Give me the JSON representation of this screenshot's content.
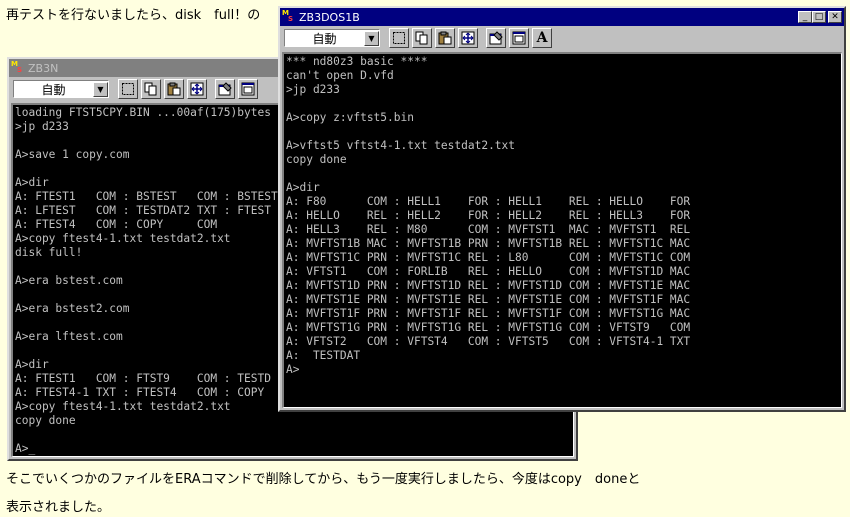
{
  "page": {
    "top_text": "再テストを行ないましたら、disk　full！の",
    "bottom_text_line1": "そこでいくつかのファイルをERAコマンドで削除してから、もう一度実行しましたら、今度はcopy　doneと",
    "bottom_text_line2": "表示されました。"
  },
  "windows": {
    "zb3n": {
      "title": "ZB3N",
      "mode_value": "自動",
      "terminal_text": "loading FTST5CPY.BIN ...00af(175)bytes\n>jp d233\n\nA>save 1 copy.com\n\nA>dir\nA: FTEST1   COM : BSTEST   COM : BSTEST\nA: LFTEST   COM : TESTDAT2 TXT : FTEST\nA: FTEST4   COM : COPY     COM\nA>copy ftest4-1.txt testdat2.txt\ndisk full!\n\nA>era bstest.com\n\nA>era bstest2.com\n\nA>era lftest.com\n\nA>dir\nA: FTEST1   COM : FTST9    COM : TESTD\nA: FTEST4-1 TXT : FTEST4   COM : COPY\nA>copy ftest4-1.txt testdat2.txt\ncopy done\n\nA>_"
    },
    "zb3dos1b": {
      "title": "ZB3DOS1B",
      "mode_value": "自動",
      "terminal_text": "*** nd80z3 basic ****\ncan't open D.vfd\n>jp d233\n\nA>copy z:vftst5.bin\n\nA>vftst5 vftst4-1.txt testdat2.txt\ncopy done\n\nA>dir\nA: F80      COM : HELL1    FOR : HELL1    REL : HELLO    FOR\nA: HELLO    REL : HELL2    FOR : HELL2    REL : HELL3    FOR\nA: HELL3    REL : M80      COM : MVFTST1  MAC : MVFTST1  REL\nA: MVFTST1B MAC : MVFTST1B PRN : MVFTST1B REL : MVFTST1C MAC\nA: MVFTST1C PRN : MVFTST1C REL : L80      COM : MVFTST1C COM\nA: VFTST1   COM : FORLIB   REL : HELLO    COM : MVFTST1D MAC\nA: MVFTST1D PRN : MVFTST1D REL : MVFTST1D COM : MVFTST1E MAC\nA: MVFTST1E PRN : MVFTST1E REL : MVFTST1E COM : MVFTST1F MAC\nA: MVFTST1F PRN : MVFTST1F REL : MVFTST1F COM : MVFTST1G MAC\nA: MVFTST1G PRN : MVFTST1G REL : MVFTST1G COM : VFTST9   COM\nA: VFTST2   COM : VFTST4   COM : VFTST5   COM : VFTST4-1 TXT\nA:  TESTDAT\nA>"
    }
  },
  "icons": [
    "select-icon",
    "copy-icon",
    "paste-icon",
    "fullscreen-icon",
    "properties-icon",
    "background-icon",
    "font-icon"
  ],
  "colors": {
    "page_bg": "#ffffe0",
    "title_active": "#000080",
    "title_inactive": "#808080",
    "window_face": "#c0c0c0",
    "terminal_bg": "#000000",
    "terminal_fg": "#c0c0c0"
  }
}
